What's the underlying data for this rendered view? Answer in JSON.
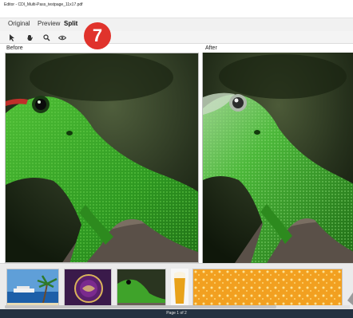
{
  "window": {
    "title": "Editor - CDI_Multi-Pass_testpage_11x17.pdf"
  },
  "tabs": [
    {
      "label": "Original",
      "active": false
    },
    {
      "label": "Preview",
      "active": false
    },
    {
      "label": "Split",
      "active": true
    }
  ],
  "badge": {
    "number": "7",
    "color": "#e0332c"
  },
  "toolbar": {
    "icons": [
      "pointer-icon",
      "hand-icon",
      "zoom-icon",
      "eye-icon"
    ]
  },
  "panes": {
    "before_label": "Before",
    "after_label": "After"
  },
  "thumbnails": [
    {
      "icon": "cruise-ship-palm-thumbnail"
    },
    {
      "icon": "purple-emblem-thumbnail"
    },
    {
      "icon": "green-lizard-thumbnail"
    },
    {
      "icon": "beer-glass-thumbnail"
    },
    {
      "icon": "beer-foam-thumbnail"
    },
    {
      "icon": "partial-thumbnail"
    }
  ],
  "status": {
    "page_text": "Page 1 of 2"
  },
  "colors": {
    "statusbar": "#233140",
    "lizard_green": "#3fa32a",
    "lizard_eye_red": "#c0302a"
  }
}
